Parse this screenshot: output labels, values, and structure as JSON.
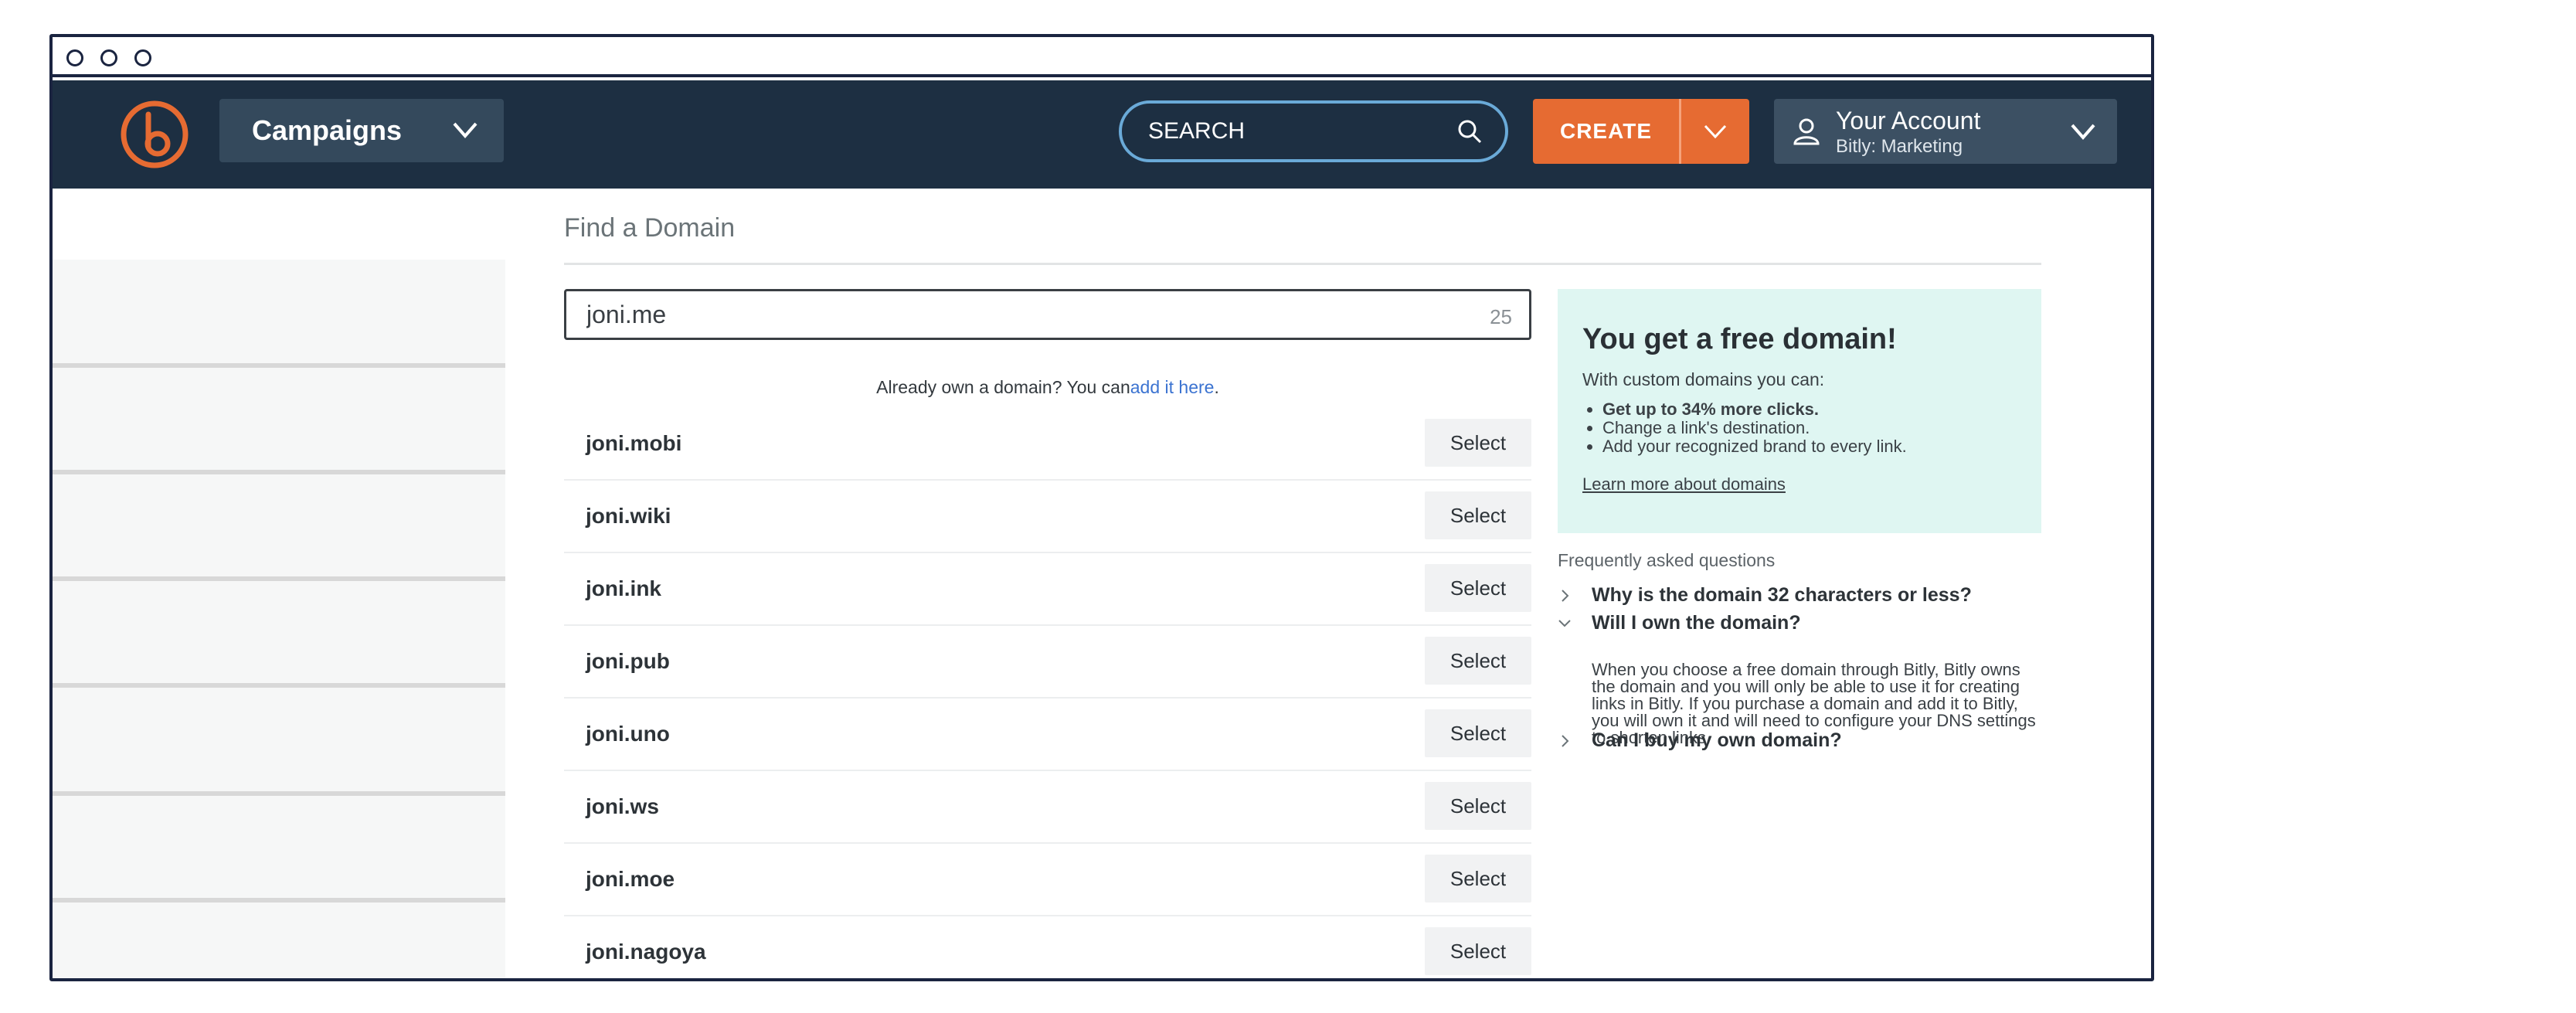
{
  "nav": {
    "campaigns_label": "Campaigns",
    "search_placeholder": "SEARCH",
    "create_label": "CREATE",
    "account_name": "Your Account",
    "account_sub": "Bitly: Marketing"
  },
  "main": {
    "title": "Find a Domain",
    "domain_query": "joni.me",
    "char_count": "25",
    "own_note_prefix": "Already own a domain? You can",
    "own_note_link": "add it here",
    "own_note_suffix": ".",
    "select_label": "Select",
    "results": [
      "joni.mobi",
      "joni.wiki",
      "joni.ink",
      "joni.pub",
      "joni.uno",
      "joni.ws",
      "joni.moe",
      "joni.nagoya"
    ]
  },
  "promo": {
    "title": "You get a free domain!",
    "subtitle": "With custom domains you can:",
    "benefits": [
      "Get up to 34% more clicks.",
      "Change a link's destination.",
      "Add your recognized brand to every link."
    ],
    "link": "Learn more about domains"
  },
  "faq": {
    "heading": "Frequently asked questions",
    "q1": "Why is the domain 32 characters or less?",
    "q2": "Will I own the domain?",
    "a2": "When you choose a free domain through Bitly, Bitly owns the domain and you will only be able to use it for creating links in Bitly. If you purchase a domain and add it to Bitly, you will own it and will need to configure your DNS settings to shorten links.",
    "q3": "Can I buy my own domain?"
  },
  "colors": {
    "nav_bg": "#1d2f42",
    "accent_orange": "#e66b32",
    "promo_bg": "#dff6f2",
    "link_blue": "#3b73d1"
  }
}
